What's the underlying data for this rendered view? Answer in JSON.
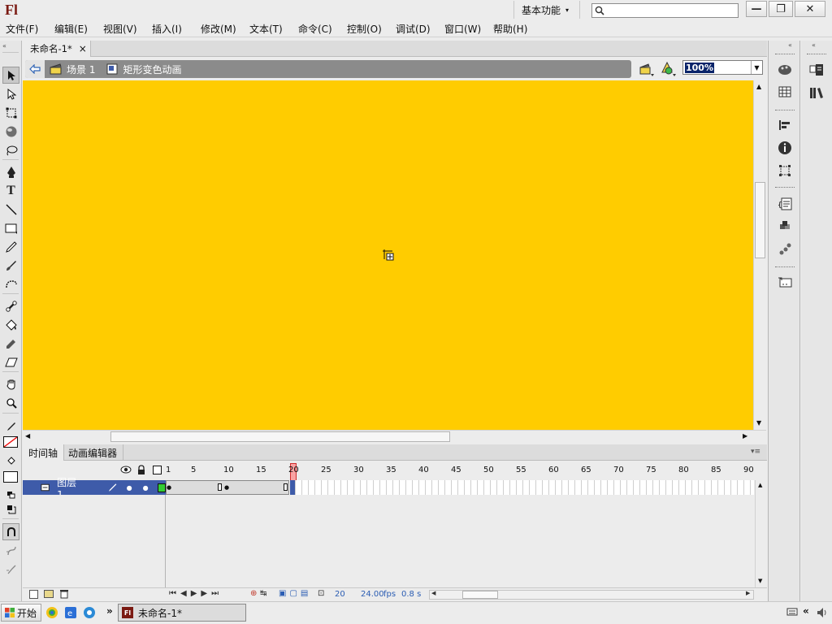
{
  "app": {
    "logo": "Fl",
    "workspace": "基本功能",
    "search_placeholder": ""
  },
  "window_controls": {
    "minimize": "—",
    "restore": "❐",
    "close": "✕"
  },
  "menu": [
    {
      "label": "文件(F)"
    },
    {
      "label": "编辑(E)"
    },
    {
      "label": "视图(V)"
    },
    {
      "label": "插入(I)"
    },
    {
      "label": "修改(M)"
    },
    {
      "label": "文本(T)"
    },
    {
      "label": "命令(C)"
    },
    {
      "label": "控制(O)"
    },
    {
      "label": "调试(D)"
    },
    {
      "label": "窗口(W)"
    },
    {
      "label": "帮助(H)"
    }
  ],
  "document": {
    "tab_title": "未命名-1*",
    "close_glyph": "×"
  },
  "editbar": {
    "scene": "场景 1",
    "symbol": "矩形变色动画",
    "zoom": "100%"
  },
  "stage": {
    "color": "#ffcc00"
  },
  "timeline": {
    "tabs": [
      "时间轴",
      "动画编辑器"
    ],
    "frame_labels": [
      "1",
      "5",
      "10",
      "15",
      "20",
      "25",
      "30",
      "35",
      "40",
      "45",
      "50",
      "55",
      "60",
      "65",
      "70",
      "75",
      "80",
      "85",
      "90"
    ],
    "layer": {
      "name": "图层 1",
      "color": "#33cc33"
    },
    "current_frame": "20",
    "fps": "24.00",
    "fps_unit": "fps",
    "elapsed": "0.8 s"
  },
  "taskbar": {
    "start": "开始",
    "task": "未命名-1*",
    "more": "»",
    "tray_more": "«"
  }
}
